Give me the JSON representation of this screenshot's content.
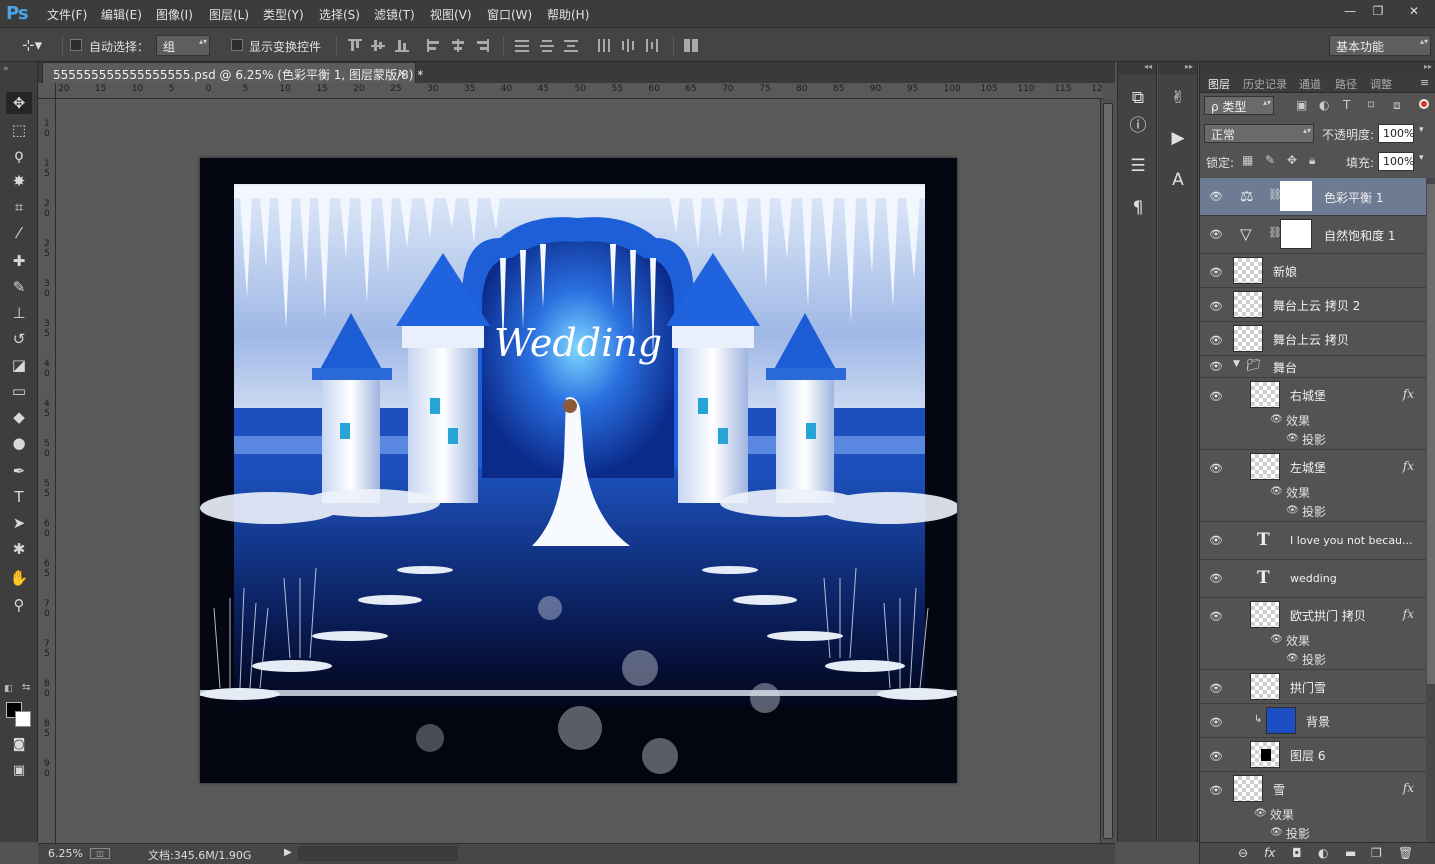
{
  "app": {
    "logo": "Ps"
  },
  "menu": [
    "文件(F)",
    "编辑(E)",
    "图像(I)",
    "图层(L)",
    "类型(Y)",
    "选择(S)",
    "滤镜(T)",
    "视图(V)",
    "窗口(W)",
    "帮助(H)"
  ],
  "window_controls": [
    "—",
    "❐",
    "✕"
  ],
  "options": {
    "auto_select_label": "自动选择：",
    "auto_select_value": "组",
    "show_transform_label": "显示变换控件",
    "workspace": "基本功能"
  },
  "document": {
    "tab_title": "555555555555555555.psd @ 6.25% (色彩平衡 1, 图层蒙版/8) *",
    "tab_close": "×",
    "ruler_h": [
      "20",
      "15",
      "10",
      "5",
      "0",
      "5",
      "10",
      "15",
      "20",
      "25",
      "30",
      "35",
      "40",
      "45",
      "50",
      "55",
      "60",
      "65",
      "70",
      "75",
      "80",
      "85",
      "90",
      "95",
      "100",
      "105",
      "110",
      "115",
      "12"
    ],
    "ruler_v": [
      "1",
      "0",
      "1",
      "5",
      "2",
      "0",
      "2",
      "5",
      "3",
      "0",
      "3",
      "5",
      "4",
      "0",
      "4",
      "5",
      "5",
      "0",
      "5",
      "5",
      "6",
      "0",
      "6",
      "5",
      "7",
      "0",
      "7",
      "5",
      "8",
      "0",
      "8",
      "5",
      "9",
      "0"
    ],
    "zoom": "6.25%",
    "doc_size": "文档:345.6M/1.90G",
    "artwork_text": "Wedding"
  },
  "tools": [
    {
      "name": "move-tool",
      "glyph": "✥"
    },
    {
      "name": "marquee-tool",
      "glyph": "⬚"
    },
    {
      "name": "lasso-tool",
      "glyph": "ϙ"
    },
    {
      "name": "magic-wand-tool",
      "glyph": "✸"
    },
    {
      "name": "crop-tool",
      "glyph": "⌗"
    },
    {
      "name": "eyedropper-tool",
      "glyph": "⁄"
    },
    {
      "name": "healing-brush-tool",
      "glyph": "✚"
    },
    {
      "name": "brush-tool",
      "glyph": "✎"
    },
    {
      "name": "clone-stamp-tool",
      "glyph": "⊥"
    },
    {
      "name": "history-brush-tool",
      "glyph": "↺"
    },
    {
      "name": "eraser-tool",
      "glyph": "◪"
    },
    {
      "name": "gradient-tool",
      "glyph": "▭"
    },
    {
      "name": "blur-tool",
      "glyph": "◆"
    },
    {
      "name": "dodge-tool",
      "glyph": "●"
    },
    {
      "name": "pen-tool",
      "glyph": "✒"
    },
    {
      "name": "type-tool",
      "glyph": "T"
    },
    {
      "name": "path-selection-tool",
      "glyph": "➤"
    },
    {
      "name": "shape-tool",
      "glyph": "✱"
    },
    {
      "name": "hand-tool",
      "glyph": "✋"
    },
    {
      "name": "zoom-tool",
      "glyph": "⚲"
    }
  ],
  "dock1_icons": [
    {
      "name": "adjust-icon",
      "glyph": "⧉"
    },
    {
      "name": "info-icon",
      "glyph": "ⓘ"
    },
    {
      "name": "sliders-icon",
      "glyph": "☰"
    },
    {
      "name": "paragraph-icon",
      "glyph": "¶"
    }
  ],
  "dock2_icons": [
    {
      "name": "brush-preset-icon",
      "glyph": "✌"
    },
    {
      "name": "play-icon",
      "glyph": "▶"
    },
    {
      "name": "character-icon",
      "glyph": "A"
    }
  ],
  "layers_panel": {
    "tabs": [
      "图层",
      "历史记录",
      "通道",
      "路径",
      "调整"
    ],
    "filter_kind": "ρ 类型",
    "blend_mode": "正常",
    "opacity_label": "不透明度:",
    "opacity_value": "100%",
    "lock_label": "锁定:",
    "fill_label": "填充:",
    "fill_value": "100%",
    "effects_label": "效果",
    "shadow_label": "投影",
    "layers": [
      {
        "name": "色彩平衡 1",
        "kind": "adjust-balance"
      },
      {
        "name": "自然饱和度 1",
        "kind": "adjust-vibrance"
      },
      {
        "name": "新娘",
        "kind": "pixel"
      },
      {
        "name": "舞台上云 拷贝 2",
        "kind": "pixel"
      },
      {
        "name": "舞台上云 拷贝",
        "kind": "pixel"
      },
      {
        "name": "舞台",
        "kind": "group"
      },
      {
        "name": "右城堡",
        "kind": "pixel",
        "fx": "fx"
      },
      {
        "name": "左城堡",
        "kind": "pixel",
        "fx": "fx"
      },
      {
        "name": "I love you  not becau...",
        "kind": "type"
      },
      {
        "name": "wedding",
        "kind": "type"
      },
      {
        "name": "欧式拱门 拷贝",
        "kind": "pixel",
        "fx": "fx"
      },
      {
        "name": "拱门雪",
        "kind": "pixel"
      },
      {
        "name": "背景",
        "kind": "pixel"
      },
      {
        "name": "图层 6",
        "kind": "pixel"
      },
      {
        "name": "雪",
        "kind": "pixel",
        "fx": "fx"
      }
    ]
  },
  "colors": {
    "selected_row": "#6d7c93",
    "panel_bg": "#535353",
    "artwork_blue": "#1f5fd6"
  }
}
